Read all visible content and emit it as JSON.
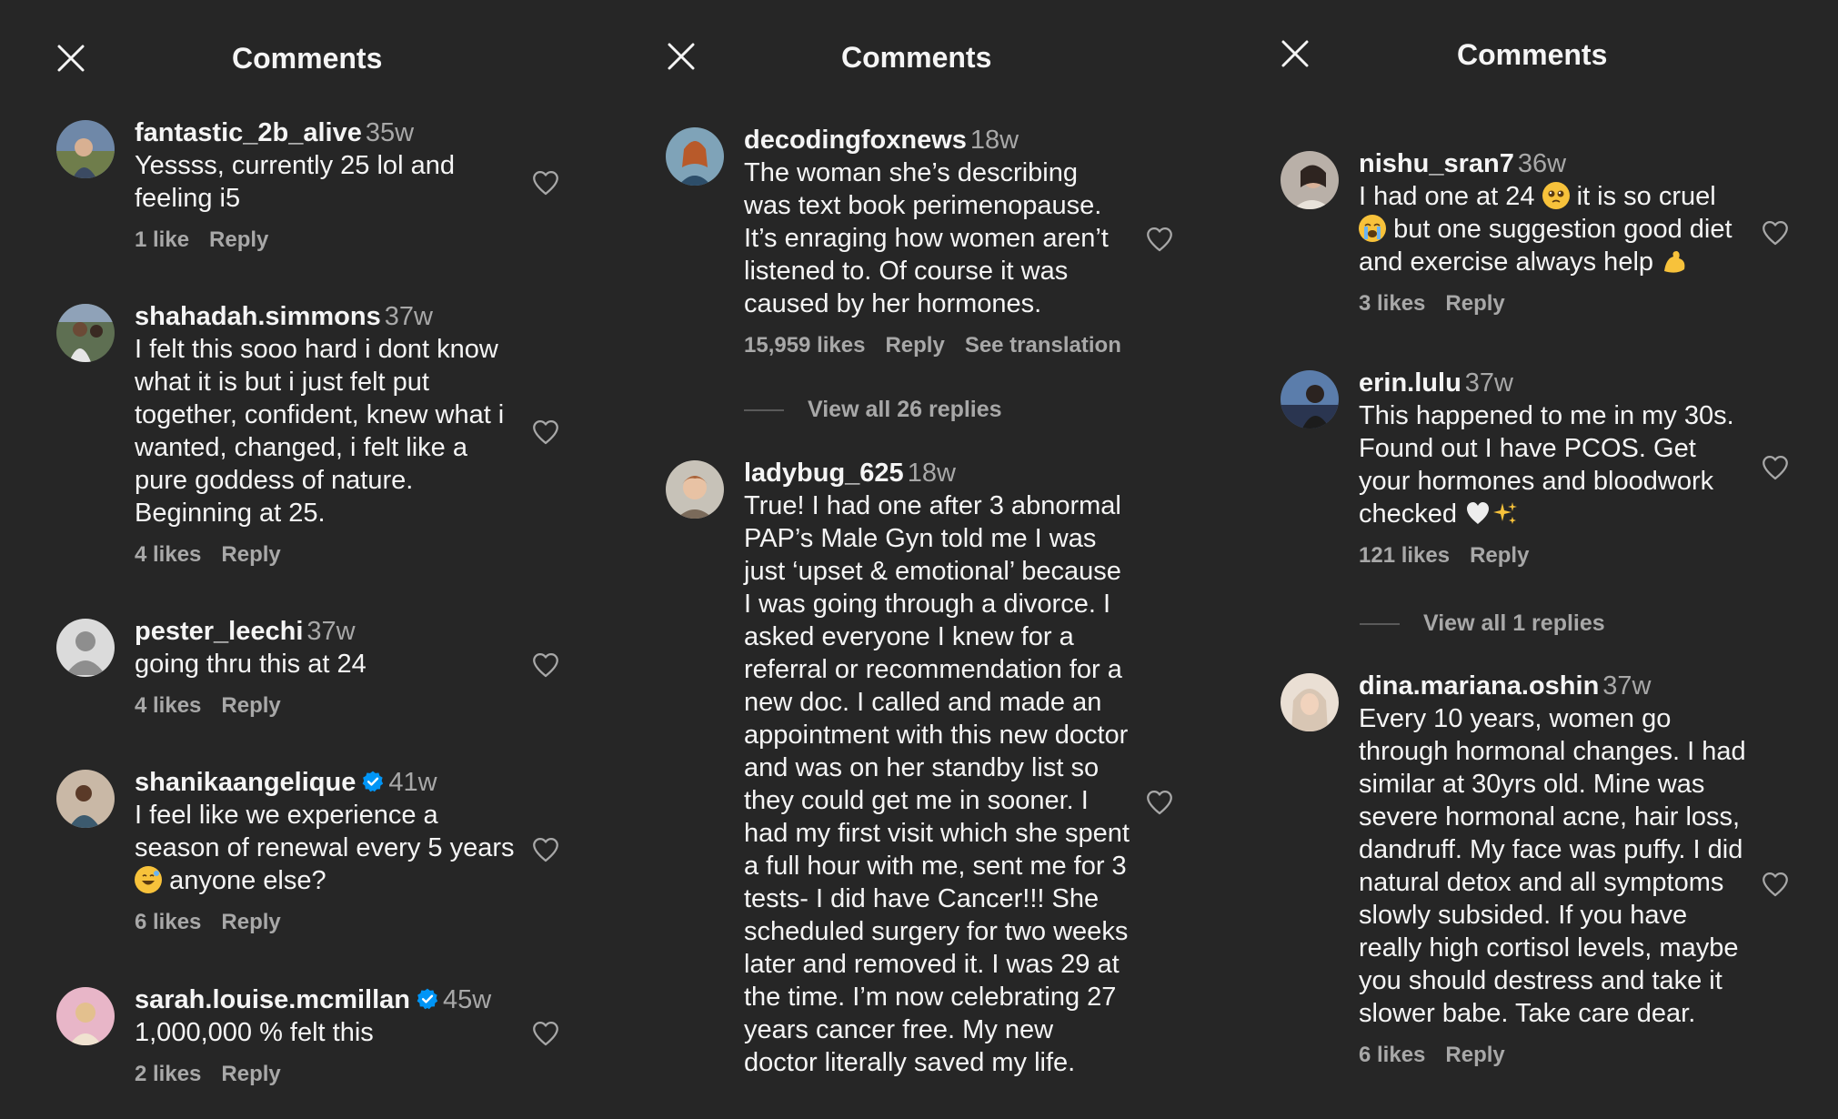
{
  "colors": {
    "background": "#262626",
    "text": "#f5f5f5",
    "secondary": "#a8a8a8",
    "verified": "#0095f6"
  },
  "panels": [
    {
      "title": "Comments",
      "comments": [
        {
          "username": "fantastic_2b_alive",
          "time": "35w",
          "text": "Yessss, currently 25 lol and feeling i5",
          "likes": "1 like",
          "reply": "Reply"
        },
        {
          "username": "shahadah.simmons",
          "time": "37w",
          "text": "I felt this sooo hard i dont know what it is but i just felt put together, confident, knew what i wanted, changed, i felt like a pure goddess of nature. Beginning at 25.",
          "likes": "4 likes",
          "reply": "Reply"
        },
        {
          "username": "pester_leechi",
          "time": "37w",
          "text": "going thru this at 24",
          "likes": "4 likes",
          "reply": "Reply"
        },
        {
          "username": "shanikaangelique",
          "time": "41w",
          "text_before": "I feel like we experience a season of renewal every 5 years",
          "text_after": "anyone else?",
          "likes": "6 likes",
          "reply": "Reply",
          "verified": true
        },
        {
          "username": "sarah.louise.mcmillan",
          "time": "45w",
          "text": "1,000,000 % felt this",
          "likes": "2 likes",
          "reply": "Reply",
          "verified": true
        }
      ]
    },
    {
      "title": "Comments",
      "comments": [
        {
          "username": "decodingfoxnews",
          "time": "18w",
          "text": "The woman she’s describing was text book perimenopause. It’s enraging how women aren’t listened to. Of course it was caused by her hormones.",
          "likes": "15,959 likes",
          "reply": "Reply",
          "translate": "See translation",
          "view_replies": "View all 26 replies"
        },
        {
          "username": "ladybug_625",
          "time": "18w",
          "text": "True! I had one after 3 abnormal PAP’s Male Gyn told me I was just ‘upset & emotional’ because I was going through a divorce. I asked everyone I knew for a referral or recommendation for a new doc. I called and made an appointment with this new doctor and was on her standby list so they could get me in sooner. I had my first visit which she spent a full hour with me, sent me for 3 tests- I did have Cancer!!! She scheduled surgery for two weeks later and removed it. I was 29 at the time. I’m now celebrating 27 years cancer free. My new doctor literally saved my life."
        }
      ]
    },
    {
      "title": "Comments",
      "comments": [
        {
          "username": "nishu_sran7",
          "time": "36w",
          "text_a": "I had one at 24",
          "text_b": "it is so cruel",
          "text_c": "but one suggestion good diet and exercise always help",
          "likes": "3 likes",
          "reply": "Reply"
        },
        {
          "username": "erin.lulu",
          "time": "37w",
          "text_before": "This happened to me in my 30s. Found out I have PCOS. Get your hormones and bloodwork checked",
          "likes": "121 likes",
          "reply": "Reply",
          "view_replies": "View all 1 replies"
        },
        {
          "username": "dina.mariana.oshin",
          "time": "37w",
          "text": "Every 10 years, women go through hormonal changes. I had similar at 30yrs old. Mine was severe hormonal acne, hair loss, dandruff. My face was puffy. I did natural detox and all symptoms slowly subsided. If you have really high cortisol levels, maybe you should destress and take it slower babe. Take care dear.",
          "likes": "6 likes",
          "reply": "Reply"
        }
      ]
    }
  ]
}
